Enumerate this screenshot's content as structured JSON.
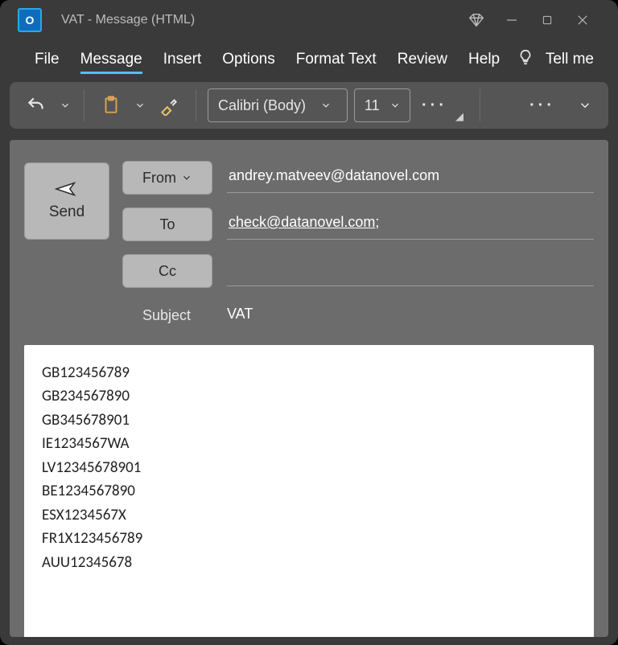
{
  "titlebar": {
    "title": "VAT  -  Message (HTML)"
  },
  "menu": {
    "items": [
      "File",
      "Message",
      "Insert",
      "Options",
      "Format Text",
      "Review",
      "Help"
    ],
    "active_index": 1,
    "tell_me": "Tell me"
  },
  "ribbon": {
    "font_name": "Calibri (Body)",
    "font_size": "11"
  },
  "compose": {
    "send_label": "Send",
    "from_label": "From",
    "to_label": "To",
    "cc_label": "Cc",
    "subject_label": "Subject",
    "from_value": "andrey.matveev@datanovel.com",
    "to_value": "check@datanovel.com",
    "to_suffix": ";",
    "cc_value": "",
    "subject_value": "VAT"
  },
  "body_lines": [
    "GB123456789",
    "GB234567890",
    "GB345678901",
    "IE1234567WA",
    "LV12345678901",
    "BE1234567890",
    "ESX1234567X",
    "FR1X123456789",
    "AUU12345678"
  ]
}
